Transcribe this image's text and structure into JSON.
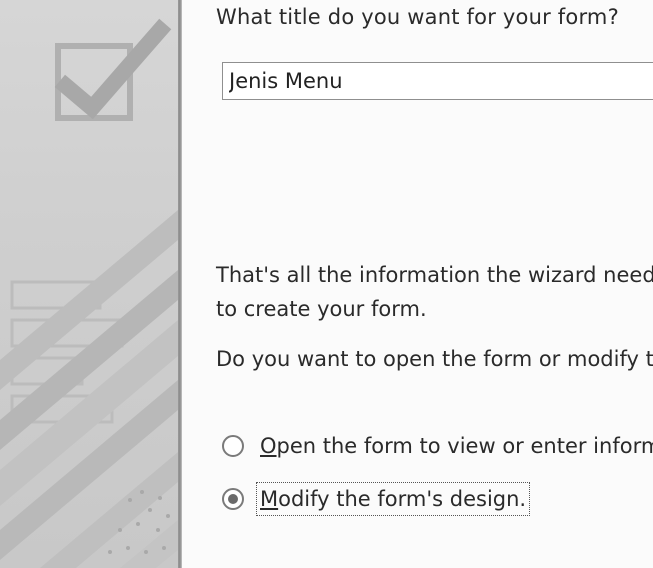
{
  "wizard": {
    "title_prompt": "What title do you want for your form?",
    "title_value": "Jenis Menu",
    "info_text": "That's all the information the wizard needs to create your form.",
    "open_prompt": "Do you want to open the form or modify the form's design?",
    "options": [
      {
        "accel": "O",
        "rest": "pen the form to view or enter information.",
        "selected": false
      },
      {
        "accel": "M",
        "rest": "odify the form's design.",
        "selected": true
      }
    ]
  },
  "side_panel": {
    "icon": "checkmark-box-icon"
  }
}
